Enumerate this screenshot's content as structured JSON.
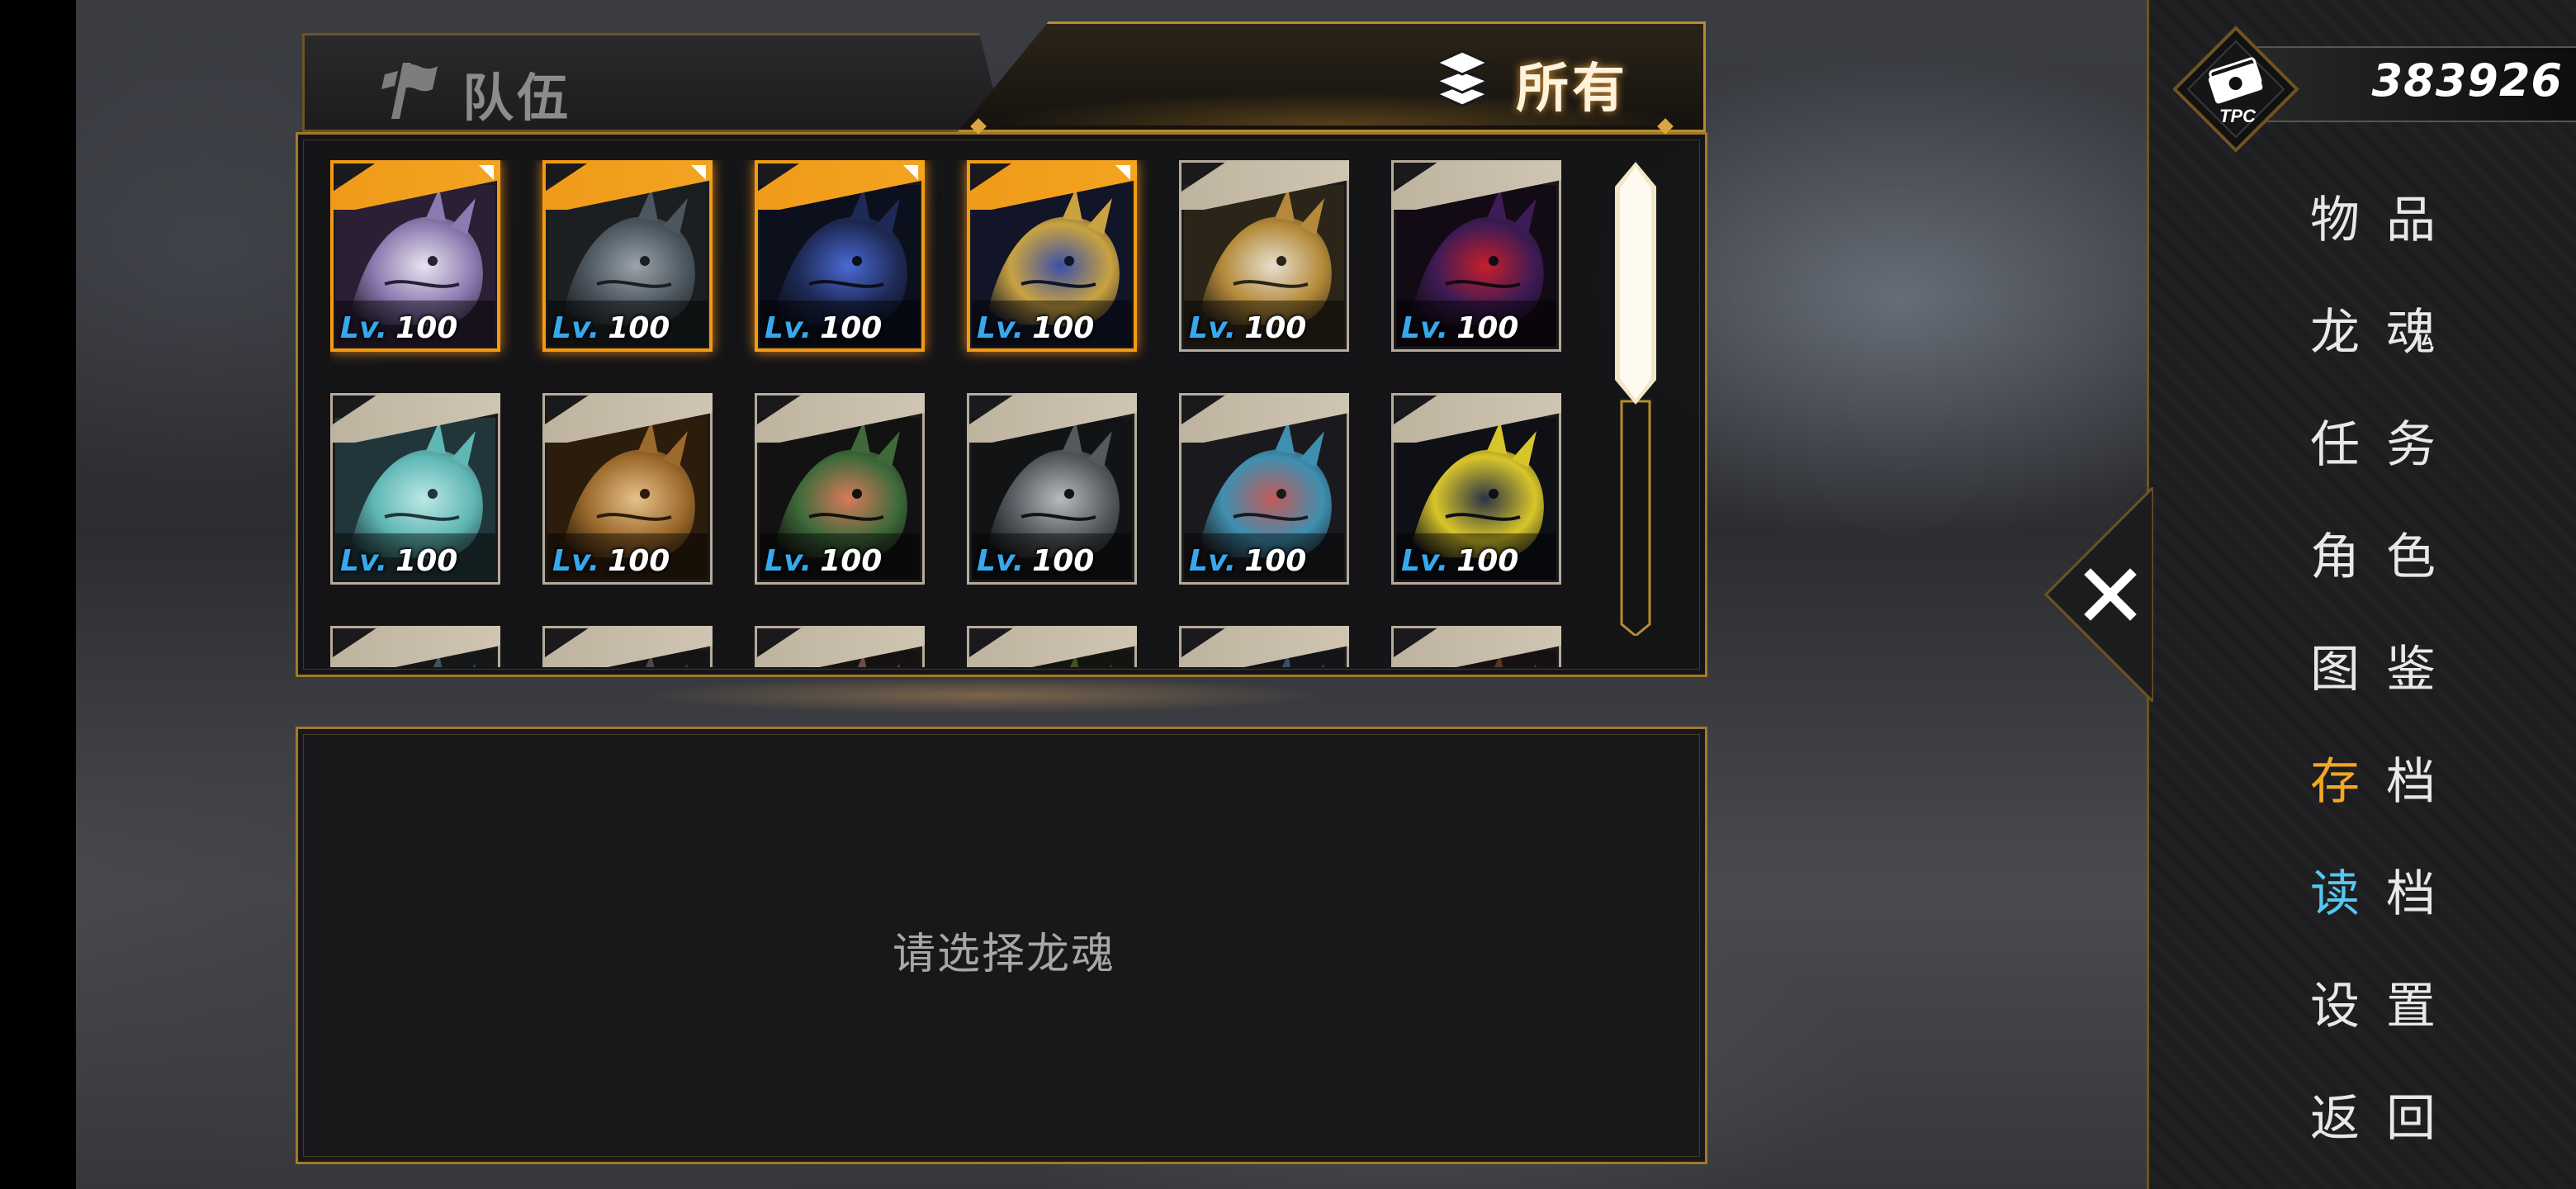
{
  "tabs": {
    "team": "队伍",
    "all": "所有"
  },
  "currency": {
    "icon": "tpc-cash-icon",
    "value": "383926"
  },
  "cards": [
    {
      "name": "white-horned-dragon",
      "lv_prefix": "Lv.",
      "level": "100",
      "selected": true,
      "palette": [
        "#e9e4f0",
        "#8c7ab0",
        "#2a1f35"
      ]
    },
    {
      "name": "grey-scaled-dragon",
      "lv_prefix": "Lv.",
      "level": "100",
      "selected": true,
      "palette": [
        "#9aa3ab",
        "#4c565e",
        "#1b1f22"
      ]
    },
    {
      "name": "dark-blue-flame-dragon",
      "lv_prefix": "Lv.",
      "level": "100",
      "selected": true,
      "palette": [
        "#4a6ad4",
        "#1e2a55",
        "#0c0f1c"
      ]
    },
    {
      "name": "blue-gold-fin-dragon",
      "lv_prefix": "Lv.",
      "level": "100",
      "selected": true,
      "palette": [
        "#3a4fa8",
        "#c9a341",
        "#121428"
      ]
    },
    {
      "name": "golden-crest-dragon",
      "lv_prefix": "Lv.",
      "level": "100",
      "selected": false,
      "palette": [
        "#e7dfcf",
        "#b48a3a",
        "#2b2418"
      ]
    },
    {
      "name": "crimson-dragon",
      "lv_prefix": "Lv.",
      "level": "100",
      "selected": false,
      "palette": [
        "#c61e2c",
        "#3d1b54",
        "#120a14"
      ]
    },
    {
      "name": "cyan-spirit-dragon",
      "lv_prefix": "Lv.",
      "level": "100",
      "selected": false,
      "palette": [
        "#bde8e6",
        "#5fb7b5",
        "#21363a"
      ]
    },
    {
      "name": "amber-maned-dragon",
      "lv_prefix": "Lv.",
      "level": "100",
      "selected": false,
      "palette": [
        "#e6c18a",
        "#9c6a2c",
        "#2c1c0c"
      ]
    },
    {
      "name": "red-wing-wyvern",
      "lv_prefix": "Lv.",
      "level": "100",
      "selected": false,
      "palette": [
        "#d97a5a",
        "#3e6a3a",
        "#121212"
      ]
    },
    {
      "name": "silver-fang-dragon",
      "lv_prefix": "Lv.",
      "level": "100",
      "selected": false,
      "palette": [
        "#b7bbbf",
        "#55595e",
        "#121314"
      ]
    },
    {
      "name": "horned-serpent-dragon",
      "lv_prefix": "Lv.",
      "level": "100",
      "selected": false,
      "palette": [
        "#c25a58",
        "#3f8fb0",
        "#1a1a1e"
      ]
    },
    {
      "name": "yellow-horn-dragon",
      "lv_prefix": "Lv.",
      "level": "100",
      "selected": false,
      "palette": [
        "#2b3344",
        "#d8c52a",
        "#0e1016"
      ]
    },
    {
      "name": "partial-card-1",
      "lv_prefix": "",
      "level": "",
      "selected": false,
      "palette": [
        "#7aa0ac",
        "#3c5660",
        "#141618"
      ]
    },
    {
      "name": "partial-card-2",
      "lv_prefix": "",
      "level": "",
      "selected": false,
      "palette": [
        "#8c8c8c",
        "#4a4a4a",
        "#141414"
      ]
    },
    {
      "name": "partial-card-3",
      "lv_prefix": "",
      "level": "",
      "selected": false,
      "palette": [
        "#c8a59a",
        "#6e4e44",
        "#161212"
      ]
    },
    {
      "name": "partial-card-4",
      "lv_prefix": "",
      "level": "",
      "selected": false,
      "palette": [
        "#7da24a",
        "#3e5226",
        "#121410"
      ]
    },
    {
      "name": "partial-card-5",
      "lv_prefix": "",
      "level": "",
      "selected": false,
      "palette": [
        "#8fa6c8",
        "#3e4c62",
        "#121418"
      ]
    },
    {
      "name": "partial-card-6",
      "lv_prefix": "",
      "level": "",
      "selected": false,
      "palette": [
        "#b87a5a",
        "#5a3424",
        "#161010"
      ]
    }
  ],
  "detail": {
    "hint": "请选择龙魂"
  },
  "menu": {
    "items": [
      {
        "id": "items",
        "first": "物",
        "second": "品",
        "highlight": ""
      },
      {
        "id": "souls",
        "first": "龙",
        "second": "魂",
        "highlight": ""
      },
      {
        "id": "quests",
        "first": "任",
        "second": "务",
        "highlight": ""
      },
      {
        "id": "chars",
        "first": "角",
        "second": "色",
        "highlight": ""
      },
      {
        "id": "codex",
        "first": "图",
        "second": "鉴",
        "highlight": ""
      },
      {
        "id": "save",
        "first": "存",
        "second": "档",
        "highlight": "#f5a623"
      },
      {
        "id": "load",
        "first": "读",
        "second": "档",
        "highlight": "#56c8f0"
      },
      {
        "id": "settings",
        "first": "设",
        "second": "置",
        "highlight": ""
      },
      {
        "id": "return",
        "first": "返",
        "second": "回",
        "highlight": ""
      }
    ]
  },
  "colors": {
    "gold_border": "#a37a2a",
    "selected_orange": "#f39a12",
    "lv_blue": "#36a8ef"
  }
}
